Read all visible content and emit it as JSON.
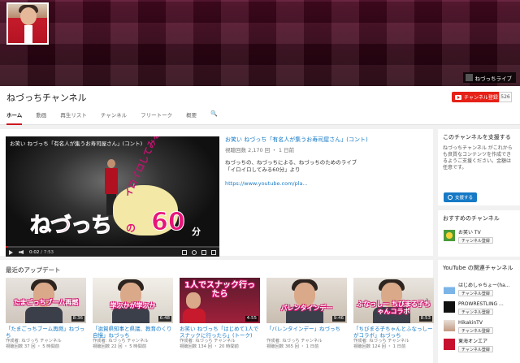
{
  "banner": {
    "live_link": "ねづっちライブ"
  },
  "channel": {
    "title": "ねづっちチャンネル",
    "subscribe_label": "チャンネル登録",
    "subscriber_count": "526"
  },
  "tabs": [
    "ホーム",
    "動画",
    "再生リスト",
    "チャンネル",
    "フリートーク",
    "概要"
  ],
  "featured": {
    "player_title": "お笑い ねづっち「有名人が集うお寿司屋さん」(コント)",
    "title": "お笑い ねづっち「有名人が集うお寿司屋さん」(コント)",
    "meta": "視聴回数 2,170 回 ・ 1 日前",
    "desc_line1": "ねづっちの、ねづっちによる、ねづっちのためのライブ",
    "desc_line2": "「イロイロしてみる60分」より",
    "url": "https://www.youtube.com/pla...",
    "time_current": "0:02",
    "time_total": "/ 7:53",
    "logo_main": "ねづっち",
    "logo_no": "の",
    "logo_cloud": "イロイロしてみる",
    "logo_num": "60",
    "logo_min": "分"
  },
  "uploads": {
    "heading": "最近のアップデート",
    "items": [
      {
        "caption": "たまごっちブーム再燃",
        "duration": "8:36",
        "title": "「たまごっちブーム再燃」ねづっち",
        "author": "作成者: ねづっち チャンネル",
        "meta": "視聴回数 37 回 ・ 5 時間前"
      },
      {
        "caption": "学ぶかが学ぶか",
        "duration": "6:48",
        "title": "「滋賀県知事と県議、教育のくり自慢」ねづっち",
        "author": "作成者: ねづっち チャンネル",
        "meta": "視聴回数 22 回 ・ 5 時間前"
      },
      {
        "caption": "1人でスナック行ったら",
        "duration": "4:55",
        "title": "お笑い ねづっち「はじめて1人でスナックに行ったら」(トーク)",
        "author": "作成者: ねづっち チャンネル",
        "meta": "視聴回数 134 回 ・ 20 時間前"
      },
      {
        "caption": "バレンタインデー",
        "duration": "9:46",
        "title": "「バレンタインデー」ねづっち",
        "author": "作成者: ねづっち チャンネル",
        "meta": "視聴回数 365 回 ・ 1 日前"
      },
      {
        "caption": "ふなっしー ちびまる子ちゃんコラボ",
        "duration": "8:53",
        "title": "「ちびまる子ちゃんとふなっしーがコラボ」ねづっち",
        "author": "作成者: ねづっち チャンネル",
        "meta": "視聴回数 124 回 ・ 1 日前"
      }
    ]
  },
  "sidebar": {
    "support": {
      "heading": "このチャンネルを支援する",
      "text": "ねづっちチャンネル がこれからも良質なコンテンツを作成できるようご支援ください。金額は任意です。",
      "button": "支援する"
    },
    "recommended": {
      "heading": "おすすめのチャンネル",
      "items": [
        {
          "name": "お笑い TV",
          "sub": "チャンネル登録"
        }
      ]
    },
    "related": {
      "heading": "YouTube の関連チャンネル",
      "items": [
        {
          "name": "はじめしゃちょー(ha...",
          "sub": "チャンネル登録"
        },
        {
          "name": "PROWRESTLING ...",
          "sub": "チャンネル登録"
        },
        {
          "name": "HikakinTV",
          "sub": "チャンネル登録"
        },
        {
          "name": "東海オンエア",
          "sub": "チャンネル登録"
        }
      ]
    }
  }
}
